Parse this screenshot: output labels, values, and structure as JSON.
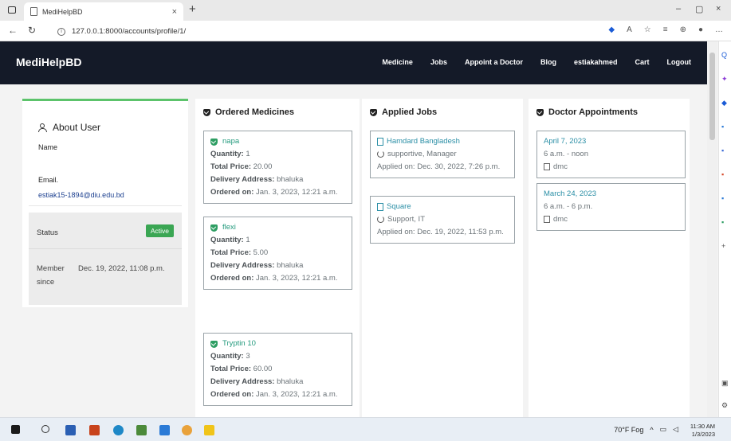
{
  "browser": {
    "tab_title": "MediHelpBD",
    "close_glyph": "×",
    "new_tab_glyph": "+",
    "url": "127.0.0.1:8000/accounts/profile/1/",
    "minimize_glyph": "–",
    "restore_glyph": "▢",
    "close_window_glyph": "×"
  },
  "navbar": {
    "brand": "MediHelpBD",
    "links": [
      "Medicine",
      "Jobs",
      "Appoint a Doctor",
      "Blog",
      "estiakahmed",
      "Cart",
      "Logout"
    ]
  },
  "profile": {
    "title": "About User",
    "name_label": "Name",
    "email_label": "Email.",
    "email": "estiak15-1894@diu.edu.bd",
    "status_label": "Status",
    "status_badge": "Active",
    "member_label": "Member since",
    "member_since": "Dec. 19, 2022, 11:08 p.m."
  },
  "orders": {
    "title": "Ordered Medicines",
    "qty_label": "Quantity:",
    "price_label": "Total Price:",
    "addr_label": "Delivery Address:",
    "ordered_label": "Ordered on:",
    "items": [
      {
        "name": "napa",
        "quantity": "1",
        "price": "20.00",
        "address": "bhaluka",
        "ordered": "Jan. 3, 2023, 12:21 a.m."
      },
      {
        "name": "flexi",
        "quantity": "1",
        "price": "5.00",
        "address": "bhaluka",
        "ordered": "Jan. 3, 2023, 12:21 a.m."
      },
      {
        "name": "Tryptin 10",
        "quantity": "3",
        "price": "60.00",
        "address": "bhaluka",
        "ordered": "Jan. 3, 2023, 12:21 a.m."
      }
    ]
  },
  "jobs": {
    "title": "Applied Jobs",
    "applied_label": "Applied on:",
    "items": [
      {
        "company": "Hamdard Bangladesh",
        "role": "supportive, Manager",
        "applied": "Dec. 30, 2022, 7:26 p.m."
      },
      {
        "company": "Square",
        "role": "Support, IT",
        "applied": "Dec. 19, 2022, 11:53 p.m."
      }
    ]
  },
  "appointments": {
    "title": "Doctor Appointments",
    "items": [
      {
        "date": "April 7, 2023",
        "time": "6 a.m. - noon",
        "place": "dmc"
      },
      {
        "date": "March 24, 2023",
        "time": "6 a.m. - 6 p.m.",
        "place": "dmc"
      }
    ]
  },
  "taskbar": {
    "weather": "70°F Fog",
    "time": "11:30 AM",
    "date": "1/3/2023"
  }
}
